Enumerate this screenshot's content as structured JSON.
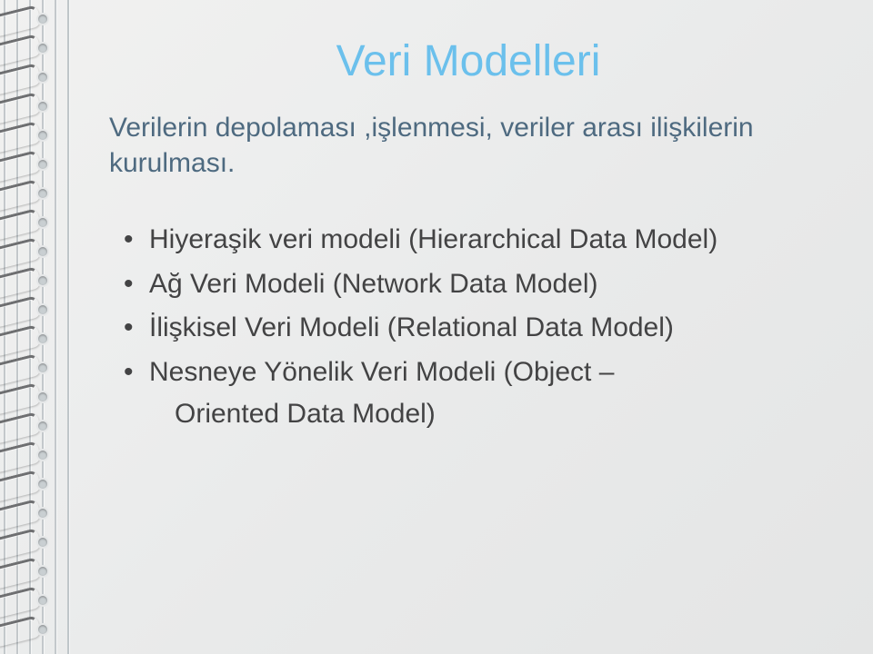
{
  "title": "Veri Modelleri",
  "subtitle": "Verilerin depolaması ,işlenmesi, veriler arası ilişkilerin kurulması.",
  "bullets": {
    "0": "Hiyeraşik veri modeli (Hierarchical Data Model)",
    "1": "Ağ Veri Modeli (Network Data Model)",
    "2": "İlişkisel Veri Modeli (Relational Data Model)",
    "3a": "Nesneye Yönelik Veri Modeli (Object –",
    "3b": "Oriented Data Model)"
  }
}
